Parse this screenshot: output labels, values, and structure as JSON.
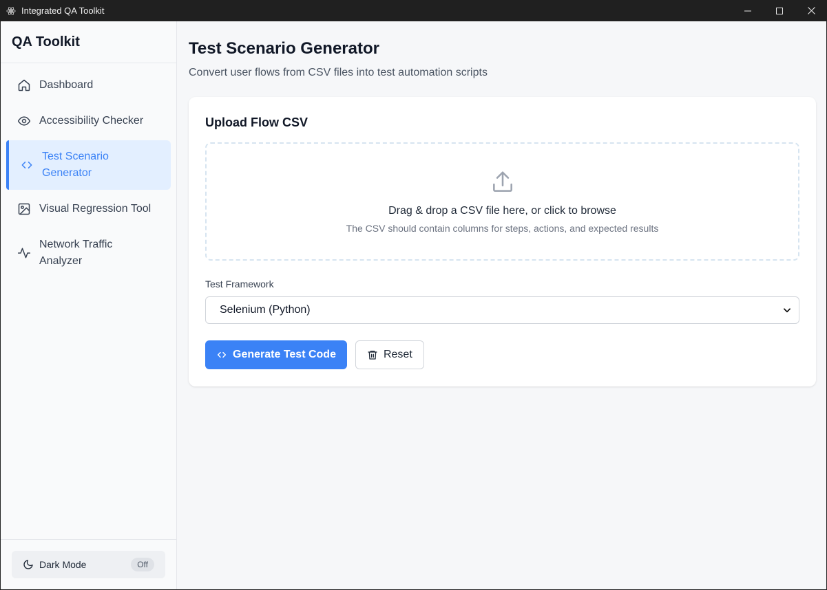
{
  "window": {
    "title": "Integrated QA Toolkit",
    "icon": "electron-atom-icon"
  },
  "sidebar": {
    "brand": "QA Toolkit",
    "items": [
      {
        "label": "Dashboard",
        "icon": "home-icon",
        "active": false
      },
      {
        "label": "Accessibility Checker",
        "icon": "eye-icon",
        "active": false
      },
      {
        "label": "Test Scenario Generator",
        "icon": "code-icon",
        "active": true
      },
      {
        "label": "Visual Regression Tool",
        "icon": "image-icon",
        "active": false
      },
      {
        "label": "Network Traffic Analyzer",
        "icon": "activity-icon",
        "active": false
      }
    ],
    "dark_mode": {
      "label": "Dark Mode",
      "state": "Off",
      "icon": "moon-icon"
    }
  },
  "main": {
    "title": "Test Scenario Generator",
    "subtitle": "Convert user flows from CSV files into test automation scripts",
    "upload": {
      "heading": "Upload Flow CSV",
      "drop_text": "Drag & drop a CSV file here, or click to browse",
      "hint": "The CSV should contain columns for steps, actions, and expected results",
      "icon": "upload-icon"
    },
    "framework": {
      "label": "Test Framework",
      "selected": "Selenium (Python)"
    },
    "actions": {
      "generate_label": "Generate Test Code",
      "reset_label": "Reset"
    }
  },
  "colors": {
    "accent": "#3b82f6",
    "active_bg": "#e3efff",
    "titlebar": "#202020"
  }
}
